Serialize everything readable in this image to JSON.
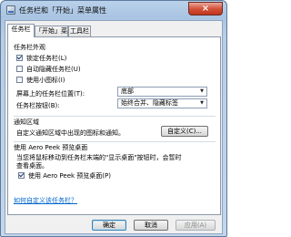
{
  "window": {
    "title": "任务栏和「开始」菜单属性",
    "close_label": "×"
  },
  "tabs": [
    {
      "label": "任务栏",
      "active": true
    },
    {
      "label": "「开始」菜单",
      "active": false
    },
    {
      "label": "工具栏",
      "active": false
    }
  ],
  "taskbar_appearance": {
    "heading": "任务栏外观",
    "options": [
      {
        "label": "锁定任务栏(L)",
        "checked": true
      },
      {
        "label": "自动隐藏任务栏(U)",
        "checked": false
      },
      {
        "label": "使用小图标(I)",
        "checked": false
      }
    ],
    "position": {
      "label": "屏幕上的任务栏位置(T):",
      "value": "底部"
    },
    "buttons": {
      "label": "任务栏按钮(B):",
      "value": "始终合并、隐藏标签"
    }
  },
  "notification_area": {
    "heading": "通知区域",
    "description": "自定义通知区域中出现的图标和通知。",
    "customize_button": "自定义(C)..."
  },
  "aero_peek": {
    "heading": "使用 Aero Peek 预览桌面",
    "description_line1": "当您将鼠标移动到任务栏末端的\"显示桌面\"按钮时，会暂时",
    "description_line2": "查看桌面。",
    "option": {
      "label": "使用 Aero Peek 预览桌面(P)",
      "checked": true
    }
  },
  "help_link": "如何自定义该任务栏？",
  "footer": {
    "ok": "确定",
    "cancel": "取消",
    "apply": "应用(A)"
  }
}
